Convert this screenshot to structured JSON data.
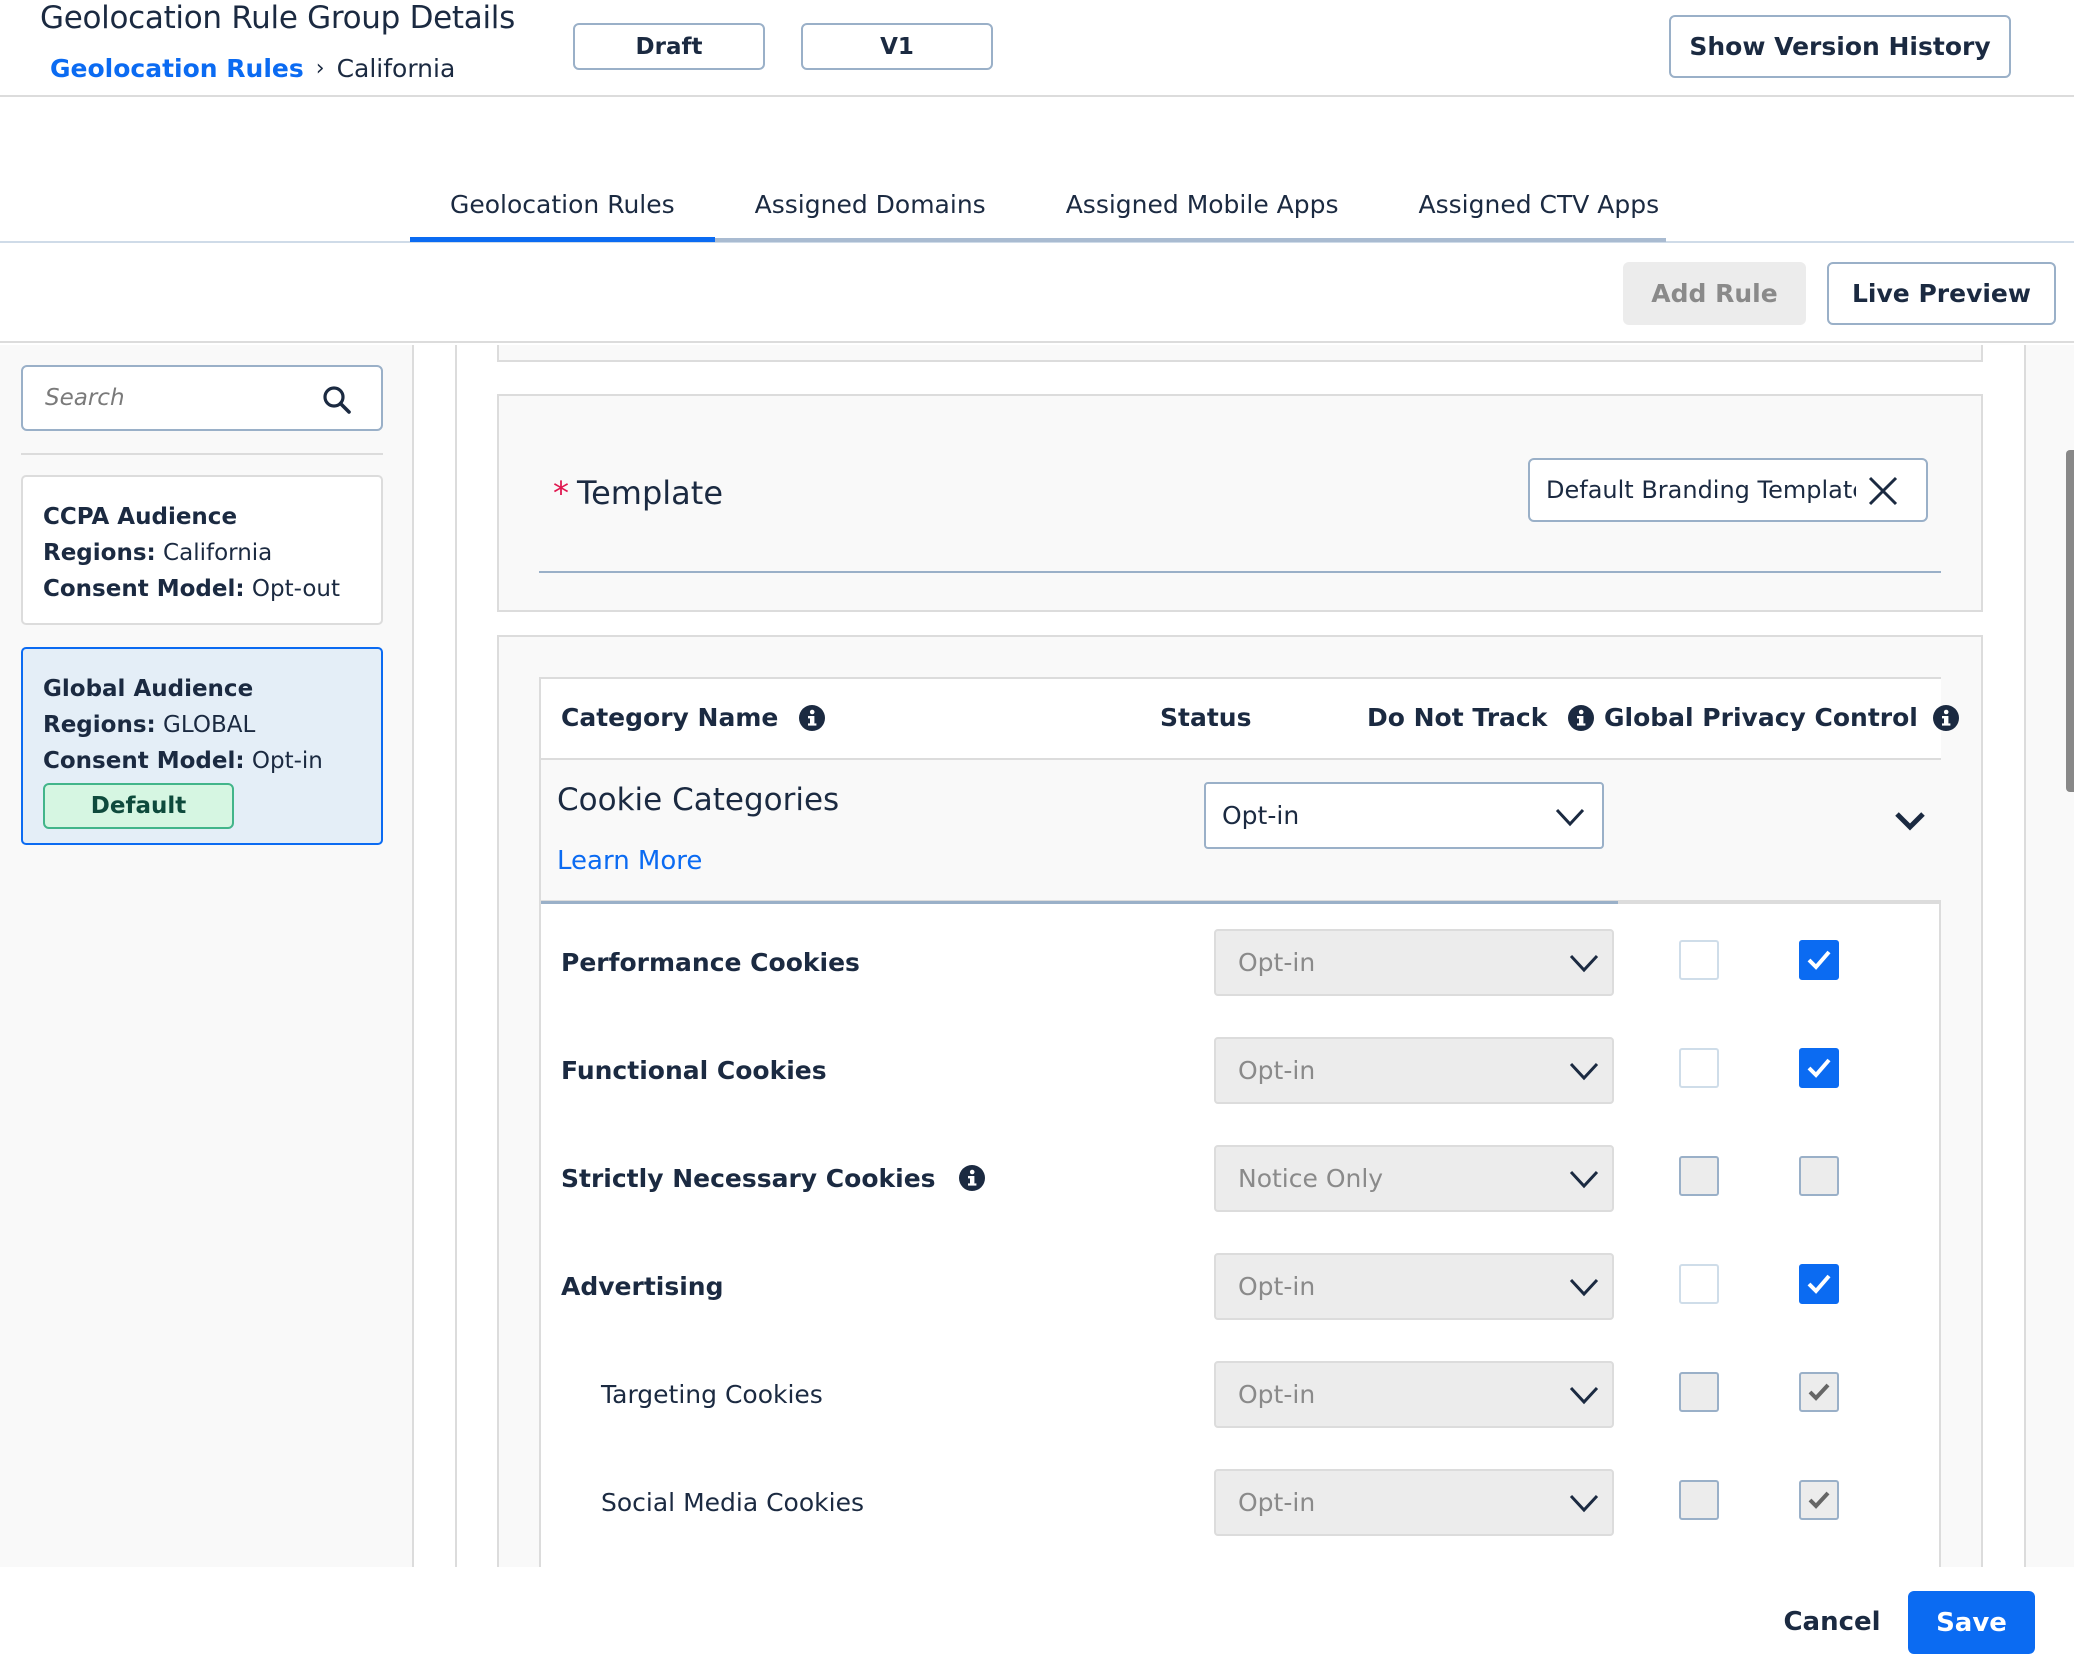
{
  "header": {
    "title": "Geolocation Rule Group Details",
    "breadcrumb": {
      "link": "Geolocation Rules",
      "separator": "›",
      "current": "California"
    },
    "status_pill": "Draft",
    "version_pill": "V1",
    "version_history_button": "Show Version History"
  },
  "tabs": [
    {
      "label": "Geolocation Rules",
      "active": true
    },
    {
      "label": "Assigned Domains",
      "active": false
    },
    {
      "label": "Assigned Mobile Apps",
      "active": false
    },
    {
      "label": "Assigned CTV Apps",
      "active": false
    }
  ],
  "toolbar": {
    "add_rule": "Add Rule",
    "live_preview": "Live Preview"
  },
  "sidebar": {
    "search": {
      "placeholder": "Search",
      "value": "",
      "icon": "search-icon"
    },
    "rules": [
      {
        "title": "CCPA Audience",
        "regions_label": "Regions:",
        "regions": "California",
        "consent_label": "Consent Model:",
        "consent": "Opt-out",
        "selected": false,
        "badge": null
      },
      {
        "title": "Global Audience",
        "regions_label": "Regions:",
        "regions": "GLOBAL",
        "consent_label": "Consent Model:",
        "consent": "Opt-in",
        "selected": true,
        "badge": "Default"
      }
    ]
  },
  "template": {
    "required_mark": "*",
    "label": "Template",
    "value": "Default Branding Template",
    "clear_icon": "close-icon"
  },
  "table": {
    "headers": {
      "category_name": "Category Name",
      "status": "Status",
      "do_not_track": "Do Not Track",
      "global_privacy_control": "Global Privacy Control"
    },
    "group": {
      "title": "Cookie Categories",
      "learn_more": "Learn More",
      "status": "Opt-in"
    },
    "rows": [
      {
        "name": "Performance Cookies",
        "bold": true,
        "indent": false,
        "info": false,
        "status": "Opt-in",
        "dnt": "unchecked",
        "gpc": "checked"
      },
      {
        "name": "Functional Cookies",
        "bold": true,
        "indent": false,
        "info": false,
        "status": "Opt-in",
        "dnt": "unchecked",
        "gpc": "checked"
      },
      {
        "name": "Strictly Necessary Cookies",
        "bold": true,
        "indent": false,
        "info": true,
        "status": "Notice Only",
        "dnt": "disabled",
        "gpc": "disabled"
      },
      {
        "name": "Advertising",
        "bold": true,
        "indent": false,
        "info": false,
        "status": "Opt-in",
        "dnt": "unchecked",
        "gpc": "checked"
      },
      {
        "name": "Targeting Cookies",
        "bold": false,
        "indent": true,
        "info": false,
        "status": "Opt-in",
        "dnt": "disabled",
        "gpc": "disabled-checked"
      },
      {
        "name": "Social Media Cookies",
        "bold": false,
        "indent": true,
        "info": false,
        "status": "Opt-in",
        "dnt": "disabled",
        "gpc": "disabled-checked"
      }
    ]
  },
  "footer": {
    "cancel": "Cancel",
    "save": "Save"
  },
  "colors": {
    "accent": "#0b6bf2",
    "text": "#1b2a41",
    "required": "#e0174f",
    "badge_bg": "#d6f6e2",
    "badge_border": "#42b58a",
    "selected_card_bg": "#e4eef7"
  }
}
